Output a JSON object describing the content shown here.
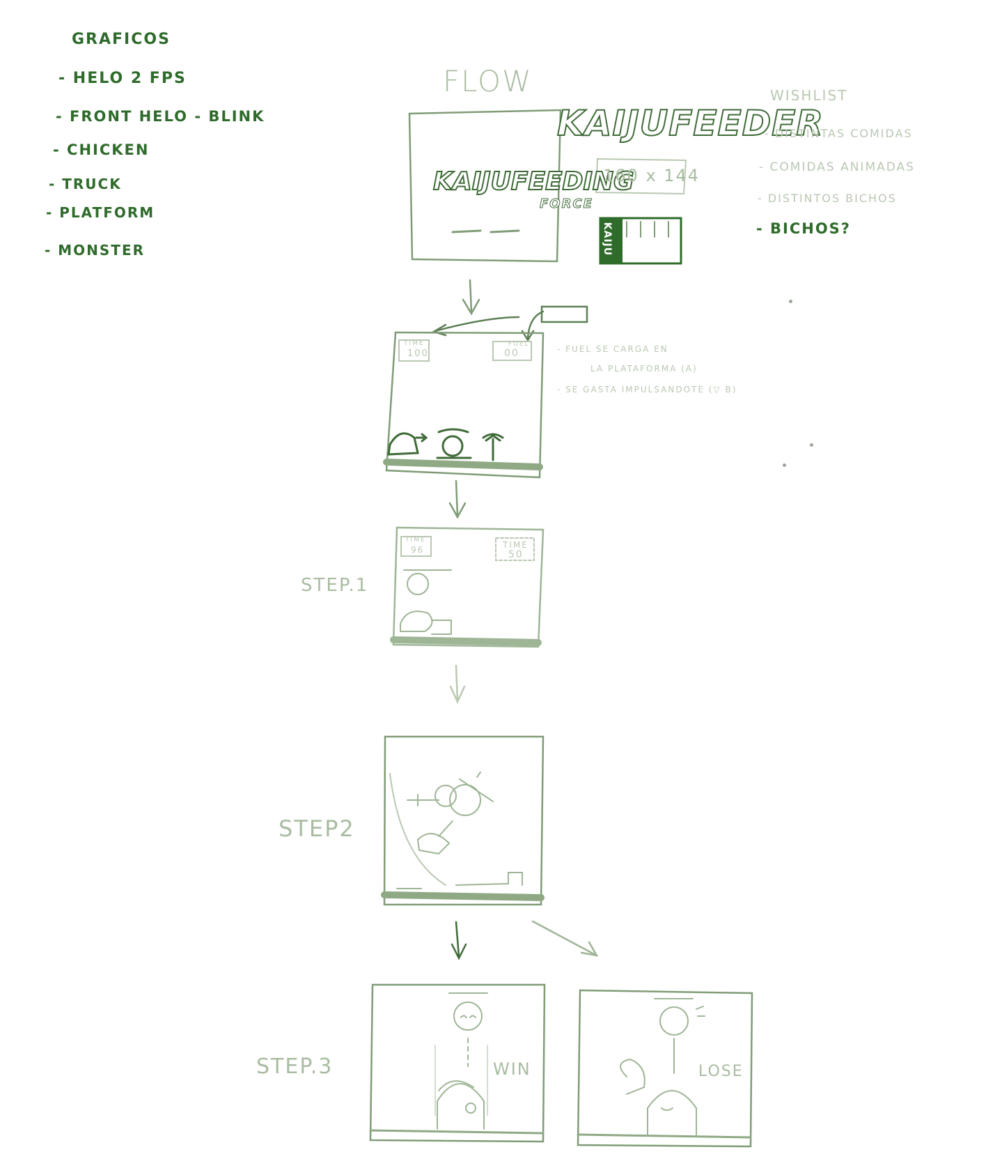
{
  "graficos": {
    "title": "GRAFICOS",
    "items": [
      "- HELO 2 FPS",
      "- FRONT HELO - BLINK",
      "- CHICKEN",
      "- TRUCK",
      "- PLATFORM",
      "- MONSTER"
    ]
  },
  "flow_title": "FLOW",
  "logo": {
    "title": "KAIJUFEEDER",
    "subtitle_logo": "KAIJUFEEDING",
    "subtitle_small": "FORCE",
    "resolution": "160 x 144",
    "badge": "KAIJU"
  },
  "wishlist": {
    "title": "WISHLIST",
    "items": [
      "- DISTINTAS COMIDAS",
      "- COMIDAS ANIMADAS",
      "- DISTINTOS BICHOS",
      "- BICHOS?"
    ]
  },
  "screen1": {
    "time_label": "TIME",
    "time_value": "100",
    "fuel_label": "FUEL",
    "fuel_value": "00",
    "notes": [
      "- FUEL SE CARGA EN",
      "LA PLATAFORMA (A)",
      "- SE GASTA IMPULSANDOTE (▽ B)"
    ]
  },
  "step1": {
    "label": "STEP.1",
    "time_label": "TIME",
    "time_value": "96",
    "time2_label": "TIME",
    "time2_value": "50"
  },
  "step2": {
    "label": "STEP2"
  },
  "step3": {
    "label": "STEP.3",
    "win": "WIN",
    "lose": "LOSE"
  },
  "colors": {
    "ink_dark": "#2f6b2b",
    "ink_mid": "#7f9c77",
    "ink_light": "#b9c8b2"
  }
}
